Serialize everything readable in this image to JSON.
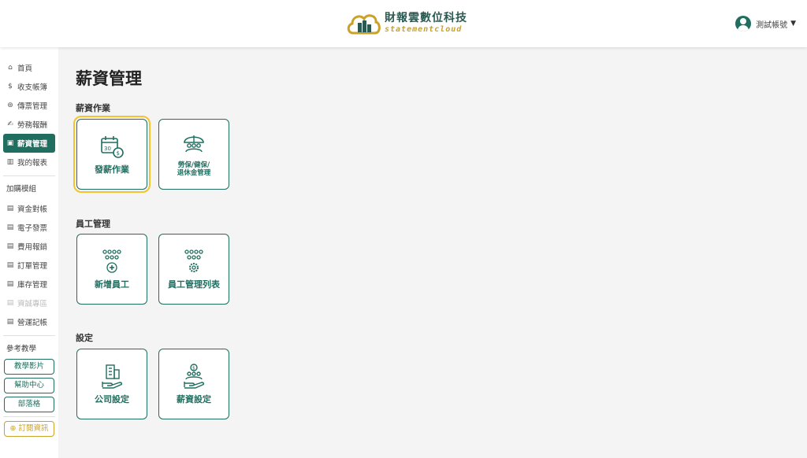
{
  "header": {
    "brand_name": "財報雲數位科技",
    "brand_sub": "statementcloud",
    "user_name": "測試帳號",
    "user_caret": "▼"
  },
  "sidebar": {
    "items": [
      {
        "label": "首頁",
        "icon": "home-icon"
      },
      {
        "label": "收支帳簿",
        "icon": "dollar-circle-icon"
      },
      {
        "label": "傳票管理",
        "icon": "voucher-icon"
      },
      {
        "label": "勞務報酬",
        "icon": "handshake-icon"
      },
      {
        "label": "薪資管理",
        "icon": "salary-icon",
        "active": true
      },
      {
        "label": "我的報表",
        "icon": "bar-chart-icon"
      }
    ],
    "addon_title": "加購模組",
    "addons": [
      {
        "label": "資金對帳"
      },
      {
        "label": "電子發票"
      },
      {
        "label": "費用報銷"
      },
      {
        "label": "訂單管理"
      },
      {
        "label": "庫存管理"
      },
      {
        "label": "資誠專區",
        "disabled": true
      },
      {
        "label": "營運記帳"
      }
    ],
    "ref_title": "參考教學",
    "ref_buttons": [
      "教學影片",
      "幫助中心",
      "部落格"
    ],
    "subscribe_label": "訂閱資訊"
  },
  "main": {
    "title": "薪資管理",
    "sections": [
      {
        "title": "薪資作業",
        "tiles": [
          {
            "label": "發薪作業",
            "icon": "calendar-payday-icon",
            "selected": true
          },
          {
            "label": "勞保/健保/\n退休金管理",
            "icon": "umbrella-insurance-icon"
          }
        ]
      },
      {
        "title": "員工管理",
        "tiles": [
          {
            "label": "新增員工",
            "icon": "add-employee-icon"
          },
          {
            "label": "員工管理列表",
            "icon": "employee-settings-icon"
          }
        ]
      },
      {
        "title": "設定",
        "tiles": [
          {
            "label": "公司設定",
            "icon": "company-building-icon"
          },
          {
            "label": "薪資設定",
            "icon": "salary-settings-icon"
          }
        ]
      }
    ]
  },
  "colors": {
    "primary": "#1f6e5f",
    "accent_gold": "#c9a227",
    "highlight": "#f4c430"
  }
}
